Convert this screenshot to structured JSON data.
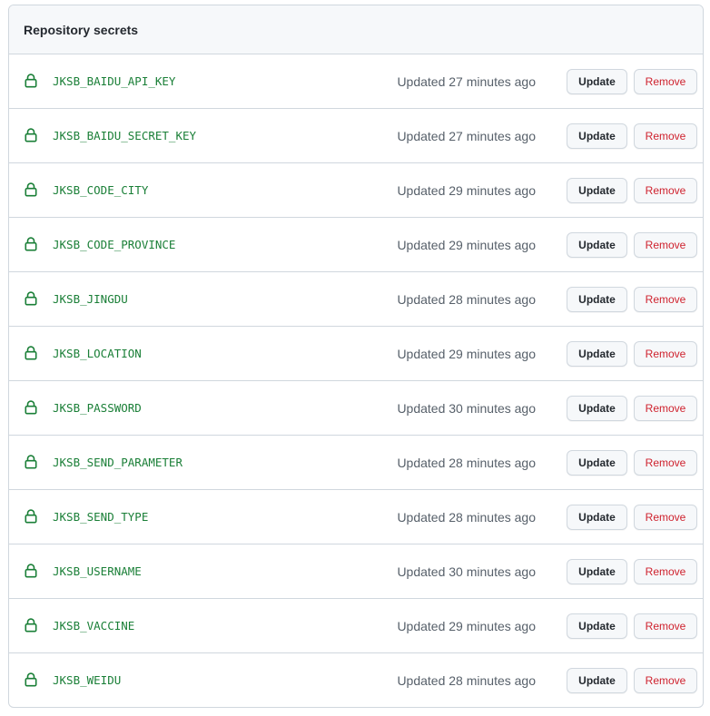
{
  "panel": {
    "title": "Repository secrets"
  },
  "labels": {
    "update": "Update",
    "remove": "Remove"
  },
  "colors": {
    "secret_name": "#1a7f37",
    "remove_text": "#cf222e",
    "border": "#d0d7de",
    "header_bg": "#f6f8fa"
  },
  "secrets": [
    {
      "name": "JKSB_BAIDU_API_KEY",
      "updated": "Updated 27 minutes ago"
    },
    {
      "name": "JKSB_BAIDU_SECRET_KEY",
      "updated": "Updated 27 minutes ago"
    },
    {
      "name": "JKSB_CODE_CITY",
      "updated": "Updated 29 minutes ago"
    },
    {
      "name": "JKSB_CODE_PROVINCE",
      "updated": "Updated 29 minutes ago"
    },
    {
      "name": "JKSB_JINGDU",
      "updated": "Updated 28 minutes ago"
    },
    {
      "name": "JKSB_LOCATION",
      "updated": "Updated 29 minutes ago"
    },
    {
      "name": "JKSB_PASSWORD",
      "updated": "Updated 30 minutes ago"
    },
    {
      "name": "JKSB_SEND_PARAMETER",
      "updated": "Updated 28 minutes ago"
    },
    {
      "name": "JKSB_SEND_TYPE",
      "updated": "Updated 28 minutes ago"
    },
    {
      "name": "JKSB_USERNAME",
      "updated": "Updated 30 minutes ago"
    },
    {
      "name": "JKSB_VACCINE",
      "updated": "Updated 29 minutes ago"
    },
    {
      "name": "JKSB_WEIDU",
      "updated": "Updated 28 minutes ago"
    }
  ],
  "icons": {
    "row_icon": "lock-icon"
  }
}
